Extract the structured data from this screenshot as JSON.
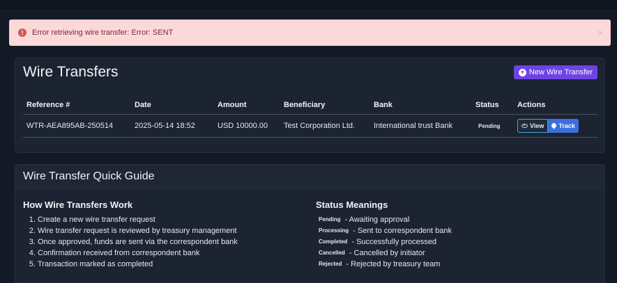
{
  "alert": {
    "message": "Error retrieving wire transfer: Error: SENT",
    "icon": "error-icon",
    "close": "×"
  },
  "transfers": {
    "title": "Wire Transfers",
    "new_button": "New Wire Transfer",
    "columns": [
      "Reference #",
      "Date",
      "Amount",
      "Beneficiary",
      "Bank",
      "Status",
      "Actions"
    ],
    "rows": [
      {
        "reference": "WTR-AEA895AB-250514",
        "date": "2025-05-14 18:52",
        "amount": "USD 10000.00",
        "beneficiary": "Test Corporation Ltd.",
        "bank": "International trust Bank",
        "status": "Pending",
        "view_label": "View",
        "track_label": "Track"
      }
    ]
  },
  "guide": {
    "title": "Wire Transfer Quick Guide",
    "how_title": "How Wire Transfers Work",
    "steps": [
      "Create a new wire transfer request",
      "Wire transfer request is reviewed by treasury management",
      "Once approved, funds are sent via the correspondent bank",
      "Confirmation received from correspondent bank",
      "Transaction marked as completed"
    ],
    "status_title": "Status Meanings",
    "statuses": [
      {
        "badge": "Pending",
        "text": "- Awaiting approval"
      },
      {
        "badge": "Processing",
        "text": "- Sent to correspondent bank"
      },
      {
        "badge": "Completed",
        "text": "- Successfully processed"
      },
      {
        "badge": "Cancelled",
        "text": "- Cancelled by initiator"
      },
      {
        "badge": "Rejected",
        "text": "- Rejected by treasury team"
      }
    ]
  }
}
